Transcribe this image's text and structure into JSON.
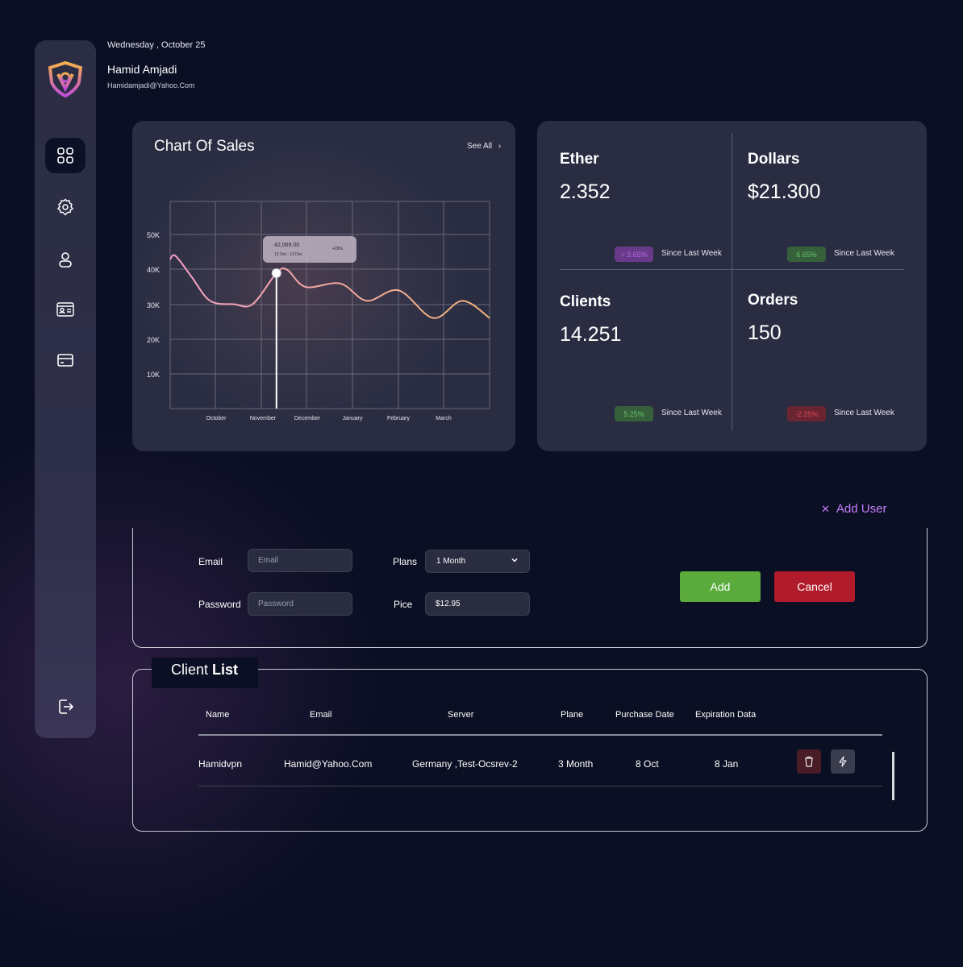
{
  "header": {
    "date": "Wednesday , October 25",
    "user_name": "Hamid Amjadi",
    "user_email": "Hamidamjadi@Yahoo.Com"
  },
  "sidebar": {
    "items": [
      {
        "icon": "dashboard-icon",
        "active": true
      },
      {
        "icon": "gear-icon",
        "active": false
      },
      {
        "icon": "user-icon",
        "active": false
      },
      {
        "icon": "id-card-icon",
        "active": false
      },
      {
        "icon": "credit-card-icon",
        "active": false
      }
    ],
    "logout_icon": "logout-icon"
  },
  "sales_chart": {
    "title": "Chart Of Sales",
    "see_all": "See All",
    "tooltip": {
      "value": "42,069.00",
      "range": "13 Oct - 13 Dec",
      "change": "+28%"
    }
  },
  "chart_data": {
    "type": "line",
    "title": "Chart Of Sales",
    "x_labels": [
      "October",
      "November",
      "December",
      "January",
      "February",
      "March"
    ],
    "y_ticks": [
      "50K",
      "40K",
      "30K",
      "20K",
      "10K"
    ],
    "ylim": [
      0,
      60000
    ],
    "grid": true,
    "series": [
      {
        "x": [
          0,
          0.1,
          0.4,
          0.75,
          1.2,
          1.55,
          2.0,
          2.2,
          2.55,
          3.2,
          3.7,
          4.3,
          4.95,
          5.5,
          5.95
        ],
        "values": [
          43000,
          44000,
          38000,
          31000,
          30000,
          30000,
          39000,
          40000,
          35000,
          36000,
          31000,
          34000,
          26000,
          31000,
          26000
        ]
      }
    ],
    "highlight": {
      "x": 2.0,
      "value": 39000
    },
    "colors": {
      "line_start": "#f7a0c8",
      "line_end": "#f0b278"
    }
  },
  "stats": [
    {
      "label": "Ether",
      "value": "2.352",
      "change": "= 3.65%",
      "since": "Since Last Week",
      "badge_bg": "#6a3a8a",
      "badge_fg": "#b06be0"
    },
    {
      "label": "Dollars",
      "value": "$21.300",
      "change": "6.65%",
      "since": "Since Last Week",
      "badge_bg": "#35603a",
      "badge_fg": "#6ac46e"
    },
    {
      "label": "Clients",
      "value": "14.251",
      "change": "5.25%",
      "since": "Since Last Week",
      "badge_bg": "#35603a",
      "badge_fg": "#6ac46e"
    },
    {
      "label": "Orders",
      "value": "150",
      "change": "-2.25%",
      "since": "Since Last Week",
      "badge_bg": "#6a2530",
      "badge_fg": "#e0455a"
    }
  ],
  "add_user": {
    "label": "Add User",
    "email_label": "Email",
    "email_placeholder": "Email",
    "password_label": "Password",
    "password_placeholder": "Password",
    "plans_label": "Plans",
    "plan_value": "1 Month",
    "price_label": "Pice",
    "price_value": "$12.95",
    "add_button": "Add",
    "cancel_button": "Cancel"
  },
  "client_list": {
    "title_regular": "Client",
    "title_bold": "List",
    "columns": [
      "Name",
      "Email",
      "Server",
      "Plane",
      "Purchase Date",
      "Expiration Data"
    ],
    "rows": [
      {
        "name": "Hamidvpn",
        "email": "Hamid@Yahoo.Com",
        "server": "Germany ,Test-Ocsrev-2",
        "plan": "3 Month",
        "purchase": "8 Oct",
        "expiration": "8 Jan"
      }
    ]
  },
  "colors": {
    "background": "#0b0f23",
    "card": "#2a2d42",
    "accent_purple": "#c77dff",
    "add_green": "#5aaa3c",
    "cancel_red": "#b11c2c"
  }
}
